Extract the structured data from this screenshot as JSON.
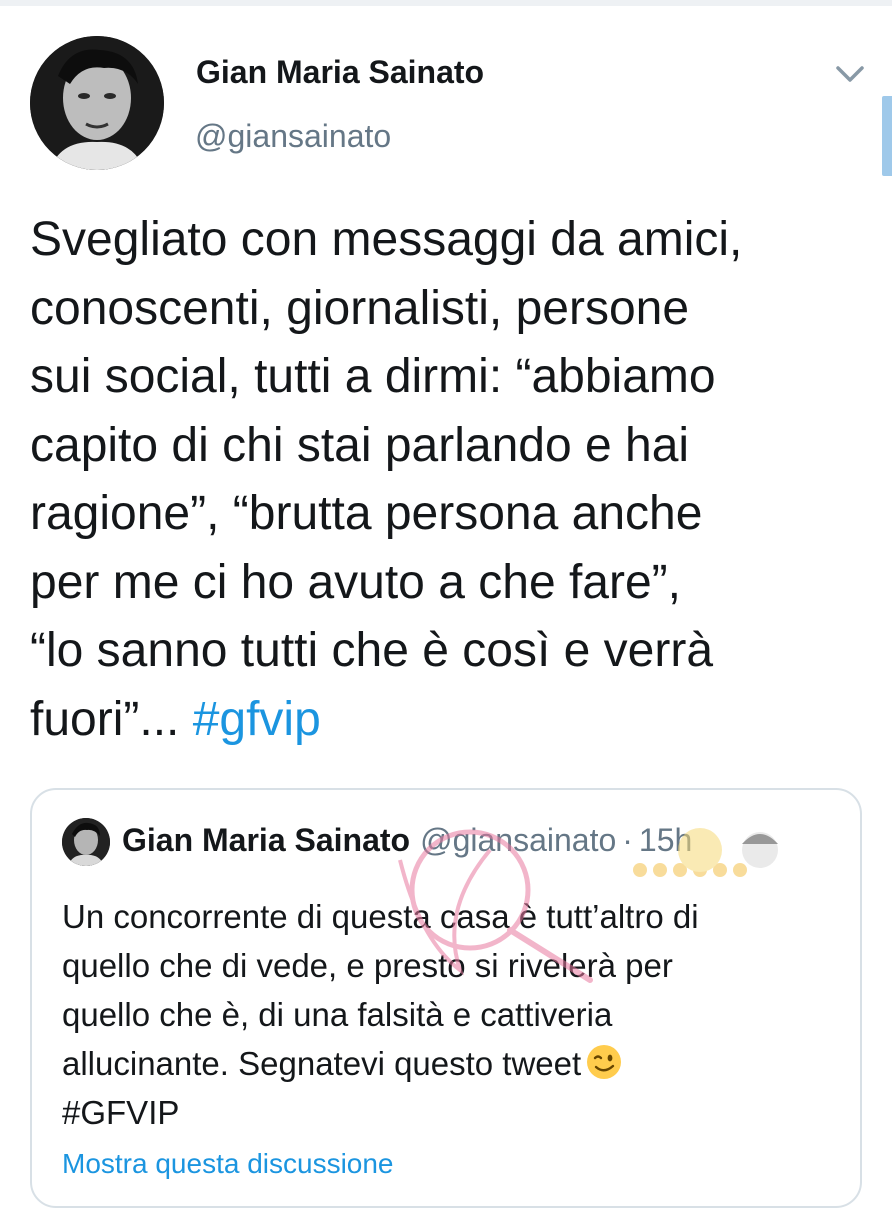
{
  "tweet": {
    "author_name": "Gian Maria Sainato",
    "author_handle": "@giansainato",
    "text": "Svegliato con messaggi da amici,\nconoscenti, giornalisti, persone\nsui social, tutti a dirmi: “abbiamo\ncapito di chi stai parlando e hai\nragione”, “brutta persona anche\nper me ci ho avuto a che fare”,\n“lo sanno tutti che è così e verrà\nfuori”... ",
    "hashtag": "#gfvip"
  },
  "quoted_tweet": {
    "author_name": "Gian Maria Sainato",
    "author_handle": "@giansainato",
    "separator": "·",
    "time": "15h",
    "text": "Un concorrente di questa casa è tutt’altro di\nquello che di vede, e presto si rivelerà per\nquello che è, di una falsità e cattiveria\nallucinante. Segnatevi questo tweet",
    "emoji": "winking-face",
    "hashtag": "#GFVIP",
    "show_thread": "Mostra questa discussione"
  },
  "icons": {
    "menu": "chevron-down-icon"
  },
  "colors": {
    "link": "#1b95e0",
    "secondary_text": "#657786",
    "border": "#d8e0e6"
  }
}
